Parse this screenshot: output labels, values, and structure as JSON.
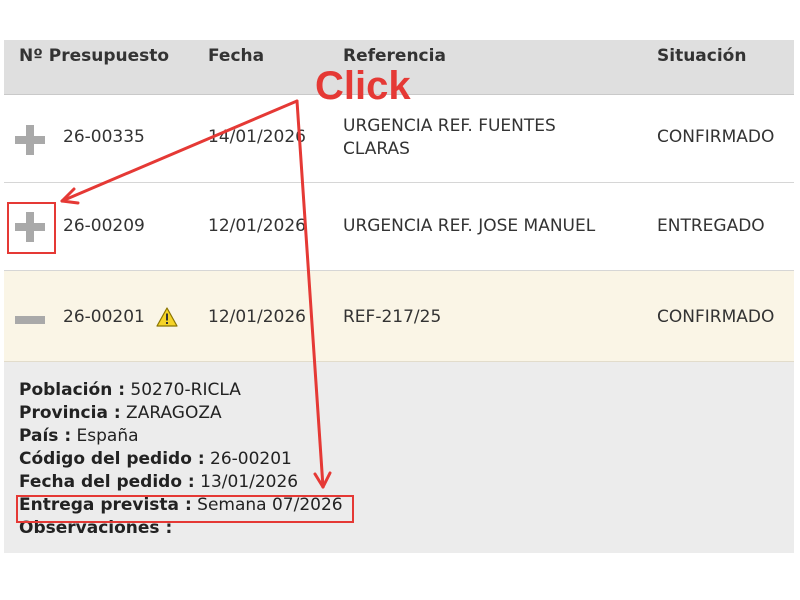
{
  "table": {
    "headers": {
      "numero": "Nº Presupuesto",
      "fecha": "Fecha",
      "referencia": "Referencia",
      "situacion": "Situación"
    },
    "rows": [
      {
        "expand_icon": "plus-icon",
        "numero": "26-00335",
        "fecha": "14/01/2026",
        "referencia_line1": "URGENCIA REF. FUENTES",
        "referencia_line2": "CLARAS",
        "situacion": "CONFIRMADO"
      },
      {
        "expand_icon": "plus-icon",
        "numero": "26-00209",
        "fecha": "12/01/2026",
        "referencia_line1": "URGENCIA REF. JOSE MANUEL",
        "referencia_line2": "",
        "situacion": "ENTREGADO"
      },
      {
        "expand_icon": "minus-icon",
        "warning_icon": "warning-icon",
        "numero": "26-00201",
        "fecha": "12/01/2026",
        "referencia_line1": "REF-217/25",
        "referencia_line2": "",
        "situacion": "CONFIRMADO"
      }
    ]
  },
  "details": {
    "poblacion": {
      "label": "Población :",
      "value": "50270-RICLA"
    },
    "provincia": {
      "label": "Provincia :",
      "value": "ZARAGOZA"
    },
    "pais": {
      "label": "País :",
      "value": "España"
    },
    "codigo": {
      "label": "Código del pedido :",
      "value": "26-00201"
    },
    "fecha_pedido": {
      "label": "Fecha del pedido :",
      "value": "13/01/2026"
    },
    "entrega": {
      "label": "Entrega prevista :",
      "value": "Semana 07/2026"
    },
    "observaciones": {
      "label": "Observaciones :",
      "value": ""
    }
  },
  "annotation": {
    "label": "Click",
    "color": "#e53935"
  },
  "colors": {
    "header_bg": "#dfdfdf",
    "expanded_row_bg": "#faf5e6",
    "details_bg": "#ececec",
    "icon_gray": "#a9a9a9",
    "warning_yellow": "#f5d327"
  }
}
